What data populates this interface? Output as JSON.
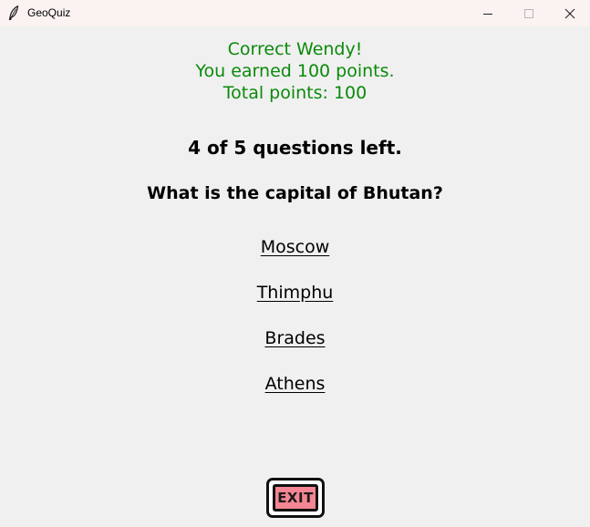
{
  "window": {
    "title": "GeoQuiz",
    "app_icon": "feather-icon",
    "controls": [
      "minimize-icon",
      "maximize-icon",
      "close-icon"
    ]
  },
  "feedback": {
    "line1": "Correct Wendy!",
    "line2": "You earned 100 points.",
    "line3": "Total points: 100",
    "color": "#0a8a0a"
  },
  "progress_text": "4 of 5 questions left.",
  "question": "What is the capital of Bhutan?",
  "options": [
    "Moscow",
    "Thimphu",
    "Brades",
    "Athens"
  ],
  "exit_button": {
    "label": "EXIT",
    "color": "#f48592"
  }
}
